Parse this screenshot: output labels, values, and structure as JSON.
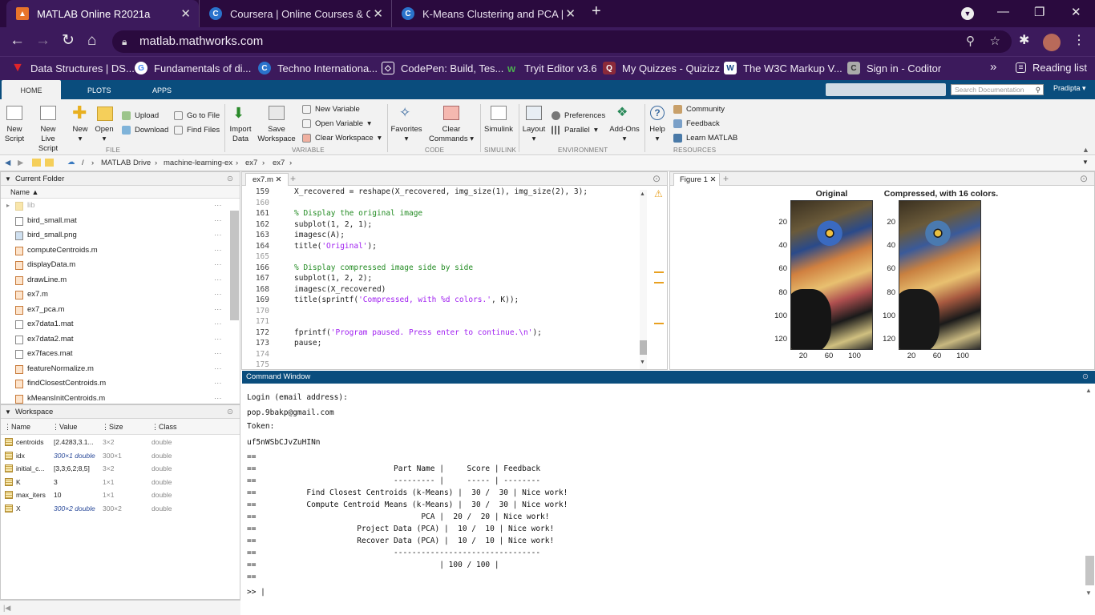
{
  "browser": {
    "tabs": [
      {
        "title": "MATLAB Online R2021a",
        "active": true
      },
      {
        "title": "Coursera | Online Courses & Cre",
        "active": false
      },
      {
        "title": "K-Means Clustering and PCA | Co",
        "active": false
      }
    ],
    "url": "matlab.mathworks.com",
    "bookmarks": [
      "Data Structures | DS...",
      "Fundamentals of di...",
      "Techno Internationa...",
      "CodePen: Build, Tes...",
      "Tryit Editor v3.6",
      "My Quizzes - Quizizz",
      "The W3C Markup V...",
      "Sign in - Coditor"
    ],
    "reading_list": "Reading list"
  },
  "toolstrip": {
    "tabs": [
      "HOME",
      "PLOTS",
      "APPS"
    ],
    "search_placeholder": "Search Documentation",
    "user": "Pradipta",
    "file": {
      "new_script": [
        "New",
        "Script"
      ],
      "new_live_script": [
        "New",
        "Live Script"
      ],
      "new": "New",
      "open": "Open",
      "upload": "Upload",
      "download": "Download",
      "go_to_file": "Go to File",
      "find_files": "Find Files",
      "group": "FILE"
    },
    "variable": {
      "import": [
        "Import",
        "Data"
      ],
      "save": [
        "Save",
        "Workspace"
      ],
      "new_variable": "New Variable",
      "open_variable": "Open Variable",
      "clear_workspace": "Clear Workspace",
      "group": "VARIABLE"
    },
    "code": {
      "favorites": "Favorites",
      "clear_commands": [
        "Clear",
        "Commands"
      ],
      "group": "CODE"
    },
    "simulink": {
      "label": "Simulink",
      "group": "SIMULINK"
    },
    "environment": {
      "layout": "Layout",
      "preferences": "Preferences",
      "parallel": "Parallel",
      "addons": "Add-Ons",
      "group": "ENVIRONMENT"
    },
    "resources": {
      "help": "Help",
      "community": "Community",
      "feedback": "Feedback",
      "learn": "Learn MATLAB",
      "group": "RESOURCES"
    }
  },
  "path": [
    "/",
    "MATLAB Drive",
    "machine-learning-ex",
    "ex7",
    "ex7"
  ],
  "current_folder": {
    "title": "Current Folder",
    "column": "Name",
    "files": [
      "lib",
      "bird_small.mat",
      "bird_small.png",
      "computeCentroids.m",
      "displayData.m",
      "drawLine.m",
      "ex7.m",
      "ex7_pca.m",
      "ex7data1.mat",
      "ex7data2.mat",
      "ex7faces.mat",
      "featureNormalize.m",
      "findClosestCentroids.m",
      "kMeansInitCentroids.m"
    ]
  },
  "workspace": {
    "title": "Workspace",
    "columns": [
      "Name",
      "Value",
      "Size",
      "Class"
    ],
    "rows": [
      {
        "name": "centroids",
        "value": "[2.4283,3.1...",
        "size": "3×2",
        "class": "double"
      },
      {
        "name": "idx",
        "value": "300×1 double",
        "size": "300×1",
        "class": "double"
      },
      {
        "name": "initial_c...",
        "value": "[3,3;6,2;8,5]",
        "size": "3×2",
        "class": "double"
      },
      {
        "name": "K",
        "value": "3",
        "size": "1×1",
        "class": "double"
      },
      {
        "name": "max_iters",
        "value": "10",
        "size": "1×1",
        "class": "double"
      },
      {
        "name": "X",
        "value": "300×2 double",
        "size": "300×2",
        "class": "double"
      }
    ]
  },
  "editor": {
    "tab": "ex7.m",
    "lines": [
      {
        "n": "159",
        "text": "X_recovered = reshape(X_recovered, img_size(1), img_size(2), 3);"
      },
      {
        "n": "160",
        "text": ""
      },
      {
        "n": "161",
        "text": "% Display the original image",
        "type": "comment"
      },
      {
        "n": "162",
        "text": "subplot(1, 2, 1);"
      },
      {
        "n": "163",
        "text": "imagesc(A);"
      },
      {
        "n": "164",
        "pre": "title(",
        "str": "'Original'",
        "post": ");"
      },
      {
        "n": "165",
        "text": ""
      },
      {
        "n": "166",
        "text": "% Display compressed image side by side",
        "type": "comment"
      },
      {
        "n": "167",
        "text": "subplot(1, 2, 2);"
      },
      {
        "n": "168",
        "text": "imagesc(X_recovered)"
      },
      {
        "n": "169",
        "pre": "title(sprintf(",
        "str": "'Compressed, with %d colors.'",
        "post": ", K));"
      },
      {
        "n": "170",
        "text": ""
      },
      {
        "n": "171",
        "text": ""
      },
      {
        "n": "172",
        "pre": "fprintf(",
        "str": "'Program paused. Press enter to continue.\\n'",
        "post": ");"
      },
      {
        "n": "173",
        "text": "pause;"
      },
      {
        "n": "174",
        "text": ""
      },
      {
        "n": "175",
        "text": ""
      }
    ]
  },
  "figure": {
    "tab": "Figure 1",
    "left_title": "Original",
    "right_title": "Compressed, with 16 colors.",
    "yticks": [
      "20",
      "40",
      "60",
      "80",
      "100",
      "120"
    ],
    "xticks": [
      "20",
      "60",
      "100"
    ]
  },
  "command_window": {
    "title": "Command Window",
    "lines": [
      "Login (email address):",
      "pop.9bakp@gmail.com",
      "Token:",
      "uf5nWSbCJvZuHINn",
      "==",
      "==                              Part Name |     Score | Feedback",
      "==                              --------- |     ----- | --------",
      "==           Find Closest Centroids (k-Means) |  30 /  30 | Nice work!",
      "==           Compute Centroid Means (k-Means) |  30 /  30 | Nice work!",
      "==                                    PCA |  20 /  20 | Nice work!",
      "==                      Project Data (PCA) |  10 /  10 | Nice work!",
      "==                      Recover Data (PCA) |  10 /  10 | Nice work!",
      "==                              --------------------------------",
      "==                                        | 100 / 100 |",
      "=="
    ],
    "prompt": ">>"
  },
  "colors": {
    "tab_bar": "#2a0a3e",
    "matlab_blue": "#0a4d7d",
    "comment": "#228b22",
    "string": "#a020f0"
  }
}
